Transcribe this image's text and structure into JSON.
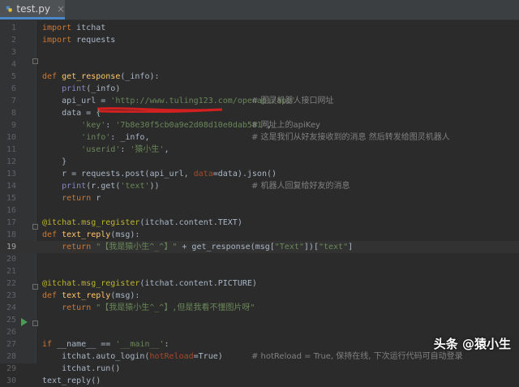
{
  "tab": {
    "filename": "test.py",
    "close_glyph": "×"
  },
  "colors": {
    "keyword": "#cc7832",
    "string": "#6a8759",
    "function": "#ffc66d",
    "comment": "#808080",
    "builtin": "#8888c6",
    "decorator": "#bbb529"
  },
  "lines": [
    {
      "n": "1",
      "text": "import itchat"
    },
    {
      "n": "2",
      "text": "import requests"
    },
    {
      "n": "3",
      "text": ""
    },
    {
      "n": "4",
      "text": ""
    },
    {
      "n": "5",
      "text": "def get_response(_info):"
    },
    {
      "n": "6",
      "text": "    print(_info)"
    },
    {
      "n": "7",
      "text": "    api_url = 'http://www.tuling123.com/openapi/api'",
      "comment": "# 图灵机器人接口网址"
    },
    {
      "n": "8",
      "text": "    data = {"
    },
    {
      "n": "9",
      "text": "        'key': '7b8e30f5cb0a9e2d08d10e0dab581',",
      "comment": "# 网址上的apiKey"
    },
    {
      "n": "10",
      "text": "        'info': _info,",
      "comment": "# 这是我们从好友接收到的消息 然后转发给图灵机器人"
    },
    {
      "n": "11",
      "text": "        'userid': '猿小生',"
    },
    {
      "n": "12",
      "text": "    }"
    },
    {
      "n": "13",
      "text": "    r = requests.post(api_url, data=data).json()"
    },
    {
      "n": "14",
      "text": "    print(r.get('text'))",
      "comment": "# 机器人回复给好友的消息"
    },
    {
      "n": "15",
      "text": "    return r"
    },
    {
      "n": "16",
      "text": ""
    },
    {
      "n": "17",
      "text": "@itchat.msg_register(itchat.content.TEXT)"
    },
    {
      "n": "18",
      "text": "def text_reply(msg):"
    },
    {
      "n": "19",
      "text": "    return \"【我是猿小生^_^】\" + get_response(msg[\"Text\"])[\"text\"]"
    },
    {
      "n": "20",
      "text": ""
    },
    {
      "n": "21",
      "text": ""
    },
    {
      "n": "22",
      "text": "@itchat.msg_register(itchat.content.PICTURE)"
    },
    {
      "n": "23",
      "text": "def text_reply(msg):"
    },
    {
      "n": "24",
      "text": "    return \"【我是猿小生^_^】,但是我看不懂图片呀\""
    },
    {
      "n": "25",
      "text": ""
    },
    {
      "n": "26",
      "text": ""
    },
    {
      "n": "27",
      "text": "if __name__ == '__main__':"
    },
    {
      "n": "28",
      "text": "    itchat.auto_login(hotReload=True)",
      "comment": "# hotReload = True, 保持在线, 下次运行代码可自动登录"
    },
    {
      "n": "29",
      "text": "    itchat.run()"
    },
    {
      "n": "30",
      "text": "text_reply()"
    }
  ],
  "watermark": "头条 @猿小生"
}
